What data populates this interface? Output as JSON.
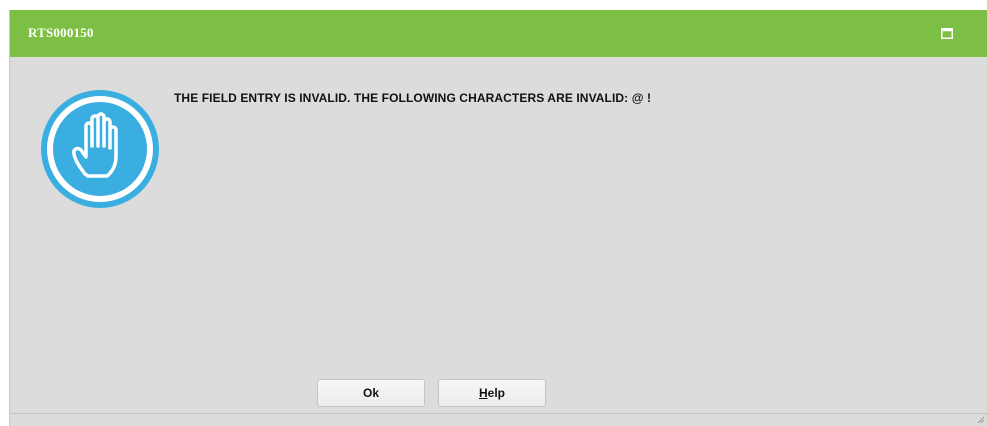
{
  "dialog": {
    "title": "RTS000150",
    "message": "THE FIELD ENTRY IS INVALID. THE FOLLOWING CHARACTERS ARE INVALID: @ !",
    "icon": "stop-hand-icon",
    "buttons": {
      "ok_label": "Ok",
      "help_label_accel": "H",
      "help_label_rest": "elp"
    }
  },
  "colors": {
    "titlebar": "#7dbf45",
    "body": "#dcdcdc",
    "icon_ring": "#3aaee0"
  }
}
